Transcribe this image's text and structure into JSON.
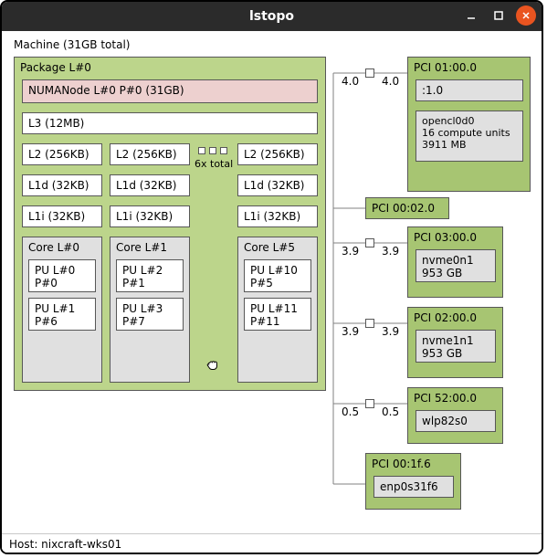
{
  "window": {
    "title": "lstopo"
  },
  "machine": {
    "label": "Machine (31GB total)"
  },
  "package": {
    "label": "Package L#0"
  },
  "numa": {
    "label": "NUMANode L#0 P#0 (31GB)"
  },
  "l3": {
    "label": "L3 (12MB)"
  },
  "caches": {
    "l2_0": "L2 (256KB)",
    "l2_1": "L2 (256KB)",
    "l2_5": "L2 (256KB)",
    "l1d_0": "L1d (32KB)",
    "l1d_1": "L1d (32KB)",
    "l1d_5": "L1d (32KB)",
    "l1i_0": "L1i (32KB)",
    "l1i_1": "L1i (32KB)",
    "l1i_5": "L1i (32KB)",
    "total": "6x total"
  },
  "cores": {
    "c0": {
      "label": "Core L#0",
      "pu_a": "PU L#0\nP#0",
      "pu_b": "PU L#1\nP#6"
    },
    "c1": {
      "label": "Core L#1",
      "pu_a": "PU L#2\nP#1",
      "pu_b": "PU L#3\nP#7"
    },
    "c5": {
      "label": "Core L#5",
      "pu_a": "PU L#10\nP#5",
      "pu_b": "PU L#11\nP#11"
    }
  },
  "bus": {
    "speed_a": "4.0",
    "speed_b": "4.0",
    "speed_c": "3.9",
    "speed_d": "3.9",
    "speed_e": "3.9",
    "speed_f": "3.9",
    "speed_g": "0.5",
    "speed_h": "0.5"
  },
  "pci": {
    "p1": {
      "label": "PCI 01:00.0",
      "sub": ":1.0",
      "dev": "opencl0d0\n16 compute units\n3911 MB"
    },
    "p2": {
      "label": "PCI 00:02.0"
    },
    "p3": {
      "label": "PCI 03:00.0",
      "dev": "nvme0n1\n953 GB"
    },
    "p4": {
      "label": "PCI 02:00.0",
      "dev": "nvme1n1\n953 GB"
    },
    "p5": {
      "label": "PCI 52:00.0",
      "dev": "wlp82s0"
    },
    "p6": {
      "label": "PCI 00:1f.6",
      "dev": "enp0s31f6"
    }
  },
  "footer": {
    "host": "Host: nixcraft-wks01"
  }
}
